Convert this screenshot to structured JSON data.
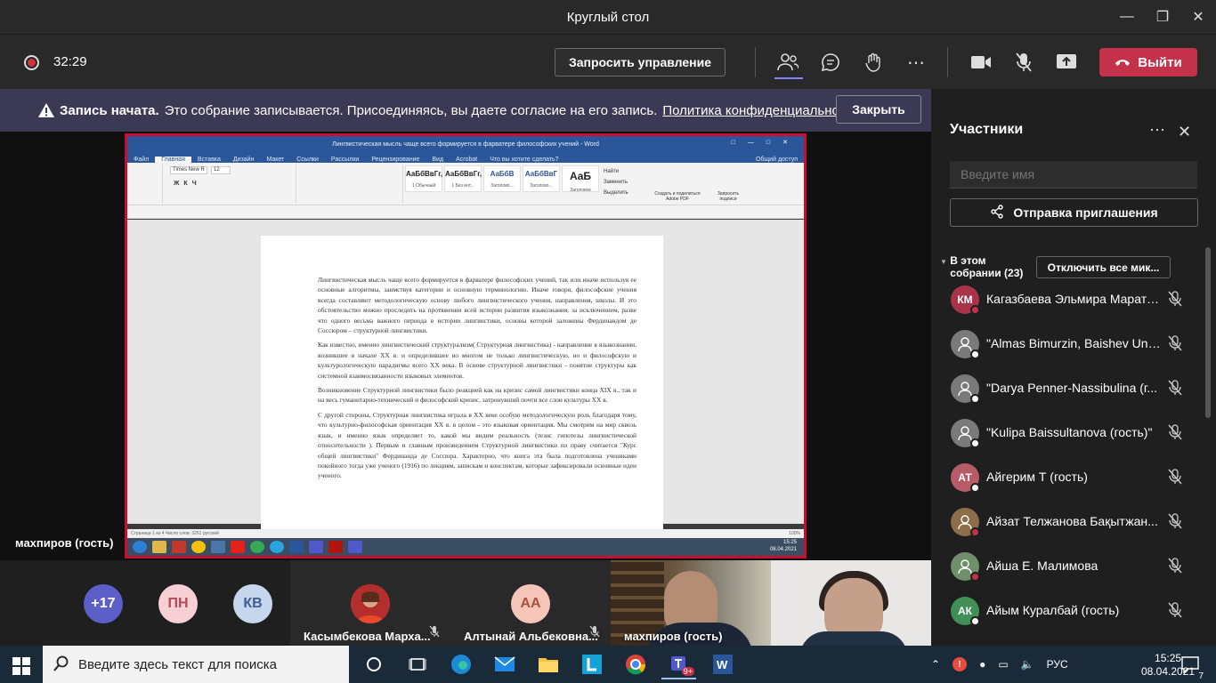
{
  "window": {
    "title": "Круглый стол"
  },
  "toolbar": {
    "timer": "32:29",
    "request_control": "Запросить управление",
    "leave": "Выйти"
  },
  "banner": {
    "bold": "Запись начата.",
    "message": "Это собрание записывается. Присоединяясь, вы даете согласие на его запись.",
    "link": "Политика конфиденциальности",
    "close": "Закрыть"
  },
  "share": {
    "presenter": "махпиров (гость)",
    "word_title": "Лингвистическая мысль чаще всего формируется  в фарватере философских учений  - Word",
    "tabs": [
      "Файл",
      "Главная",
      "Вставка",
      "Дизайн",
      "Макет",
      "Ссылки",
      "Рассылки",
      "Рецензирование",
      "Вид",
      "Acrobat",
      "Что вы хотите сделать?"
    ],
    "account": "Общий доступ",
    "font_name": "Times New R",
    "font_size": "12",
    "styles": [
      {
        "sample": "АаБбВвГг,",
        "name": "1 Обычный"
      },
      {
        "sample": "АаБбВвГг,",
        "name": "1 Без инт..."
      },
      {
        "sample": "АаБбВ",
        "name": "Заголово..."
      },
      {
        "sample": "АаБбВвГ",
        "name": "Заголово..."
      },
      {
        "sample": "АаБ",
        "name": "Заголовок"
      }
    ],
    "ribbon_right": [
      "Найти",
      "Заменить",
      "Выделить",
      "Создать и поделиться Adobe PDF",
      "Запросить подписи"
    ],
    "paragraphs": [
      "Лингвистическая мысль чаще всего формируется  в фарватере философских учений, так или иначе используя  ее основные  алгоритмы, заимствуя категории и основную терминологию. Иначе говоря, философские учения всегда составляют методологическую основу любого лингвистического учения, направления, школы. И это обстоятельство можно проследить на протяжении всей истории развития языкознания, за исключением, разве что одного весьма важного периода в истории лингвистики, основы которой заложены Фердинандом де  Соссюром – структурной лингвистики.",
      "Как известно, именно лингвистический структурализм( Структурная лингвистика) - направление в языкознании, возникшее в начале ХХ в. и определившее во многом не только лингвистическую, но и философскую и культурологическую парадигмы  всего ХХ века. В основе структурной  лингвистики  - понятие структуры как системной взаимосвязанности языковых элементов.",
      "Возникновение Структурной  лингвистики  было реакцией как на кризис самой лингвистики конца XIX в., так и на весь гуманитарно-технический и философский кризис, затронувший почти все слои культуры ХХ в.",
      "С другой стороны, Структурная лингвистика  играла в ХХ веке особую методологическую роль благодаря тому, что культурно-философская ориентация ХХ в. в целом - это языковая ориентация. Мы смотрим на мир сквозь язык, и именно язык определяет то, какой мы видим реальность (тезис гипотезы лингвистической относительности ). Первым и главным произведением Структурной  лингвистики по праву считается  \"Курс общей лингвистики\" Фердинанда де Соссюра. Характерно, что книга эта была подготовлена  учениками покойного тогда уже ученого (1916) по лекциям, запискам и конспектам, которые зафиксировали основные идеи ученого."
    ],
    "status_left": "Страница 1 из 4   Число слов: 3251   русский",
    "status_right": "100%",
    "clock_time": "15:25",
    "clock_date": "08.04.2021",
    "lang": "RU"
  },
  "tiles": {
    "more": "+17",
    "pn": "ПН",
    "kv": "КВ",
    "kasymbekova": "Касымбекова Марха...",
    "aa": "АА",
    "altynai": "Алтынай Альбековна...",
    "video1": "махпиров (гость)"
  },
  "panel": {
    "title": "Участники",
    "search_placeholder": "Введите имя",
    "invite": "Отправка приглашения",
    "section": "В этом собрании (23)",
    "mute_all": "Отключить все мик...",
    "participants": [
      {
        "initials": "КМ",
        "name": "Кагазбаева Эльмира Марато...",
        "avatar_color": "#a8334b",
        "status_color": "#c4314b"
      },
      {
        "initials": "",
        "name": "\"Almas Bimurzin, Baishev Uni...",
        "avatar_color": "#7a7a7a",
        "status_color": "#ffffff"
      },
      {
        "initials": "",
        "name": "\"Darya Penner-Nassibulina (г...",
        "avatar_color": "#7a7a7a",
        "status_color": "#ffffff"
      },
      {
        "initials": "",
        "name": "\"Kulipa Baissultanova (гость)\"",
        "avatar_color": "#7a7a7a",
        "status_color": "#ffffff"
      },
      {
        "initials": "АТ",
        "name": "Айгерим Т (гость)",
        "avatar_color": "#b75b68",
        "status_color": "#ffffff"
      },
      {
        "initials": "",
        "name": "Айзат Телжанова Бақытжан...",
        "avatar_color": "#8d6e4b",
        "status_color": "#c4314b"
      },
      {
        "initials": "",
        "name": "Айша Е. Малимова",
        "avatar_color": "#6f8f6a",
        "status_color": "#c4314b"
      },
      {
        "initials": "АК",
        "name": "Айым Куралбай (гость)",
        "avatar_color": "#3f8f57",
        "status_color": "#ffffff"
      }
    ]
  },
  "taskbar": {
    "search_placeholder": "Введите здесь текст для поиска",
    "lang": "РУС",
    "time": "15:25",
    "date": "08.04.2021",
    "notifications": "7",
    "teams_badge": "9+"
  }
}
